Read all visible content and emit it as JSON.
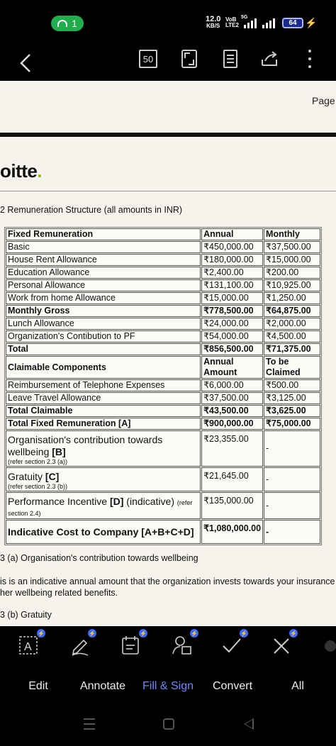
{
  "status": {
    "hotspot_count": "1",
    "speed_value": "12.0",
    "speed_unit": "KB/S",
    "volte_top": "VoB",
    "volte_bottom": "LTE2",
    "network": "5G",
    "battery": "64"
  },
  "toolbar": {
    "page_count": "50"
  },
  "doc": {
    "page_label": "Page",
    "logo_text": "oitte",
    "logo_dot": ".",
    "section_heading": "2 Remuneration Structure (all amounts in INR)",
    "table": {
      "header": [
        "Fixed Remuneration",
        "Annual",
        "Monthly"
      ],
      "fixed_rows": [
        [
          "Basic",
          "₹450,000.00",
          "₹37,500.00"
        ],
        [
          "House Rent Allowance",
          "₹180,000.00",
          "₹15,000.00"
        ],
        [
          "Education Allowance",
          "₹2,400.00",
          "₹200.00"
        ],
        [
          "Personal Allowance",
          "₹131,100.00",
          "₹10,925.00"
        ],
        [
          "Work from home Allowance",
          "₹15,000.00",
          "₹1,250.00"
        ]
      ],
      "monthly_gross": [
        "Monthly Gross",
        "₹778,500.00",
        "₹64,875.00"
      ],
      "extra_rows": [
        [
          "Lunch Allowance",
          "₹24,000.00",
          "₹2,000.00"
        ],
        [
          "Organization's Contibution to PF",
          "₹54,000.00",
          "₹4,500.00"
        ]
      ],
      "total": [
        "Total",
        "₹856,500.00",
        "₹71,375.00"
      ],
      "claimable_header": [
        "Claimable Components",
        "Annual Amount",
        "To be Claimed"
      ],
      "claimable_rows": [
        [
          "Reimbursement of Telephone Expenses",
          "₹6,000.00",
          "₹500.00"
        ],
        [
          "Leave Travel Allowance",
          "₹37,500.00",
          "₹3,125.00"
        ]
      ],
      "total_claimable": [
        "Total Claimable",
        "₹43,500.00",
        "₹3,625.00"
      ],
      "total_fixed": [
        "Total Fixed Remuneration [A]",
        "₹900,000.00",
        "₹75,000.00"
      ],
      "wellbeing": {
        "label_a": "Organisation's contribution towards wellbeing ",
        "label_b": "[B]",
        "note": "(refer section 2.3 (a))",
        "annual": "₹23,355.00",
        "monthly": "-"
      },
      "gratuity": {
        "label_a": "Gratuity ",
        "label_b": "[C]",
        "note": "(refer section 2.3 (b))",
        "annual": "₹21,645.00",
        "monthly": "-"
      },
      "incentive": {
        "label_a": "Performance Incentive ",
        "label_b": "[D]",
        "label_c": " (indicative) ",
        "note": "(refer section 2.4)",
        "annual": "₹135,000.00",
        "monthly": "-"
      },
      "ctc": {
        "label": "Indicative Cost to Company [A+B+C+D]",
        "annual": "₹1,080,000.00",
        "monthly": "-"
      }
    },
    "footnote_a_heading": "3 (a) Organisation's contribution towards wellbeing",
    "footnote_a_line1": "is is an indicative annual amount that the organization invests towards your insurance",
    "footnote_a_line2": "her wellbeing related benefits.",
    "footnote_b_heading": "3 (b) Gratuity"
  },
  "actions": [
    {
      "label": "Edit",
      "icon": "text-edit-icon",
      "active": false
    },
    {
      "label": "Annotate",
      "icon": "pen-icon",
      "active": false
    },
    {
      "label": "Fill & Sign",
      "icon": "form-icon",
      "active": true
    },
    {
      "label": "Convert",
      "icon": "user-doc-icon",
      "active": false
    },
    {
      "label": "All",
      "icon": "check-icon",
      "active": false
    }
  ],
  "colors": {
    "accent": "#6f86ff",
    "badge": "#3d6bff",
    "hotspot": "#1fae4b",
    "logo_dot": "#86bc25"
  }
}
